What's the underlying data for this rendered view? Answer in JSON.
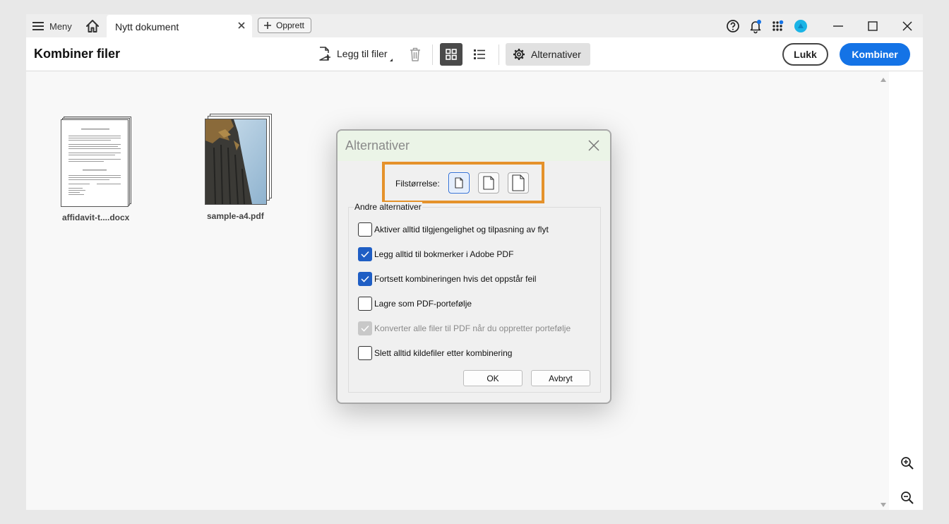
{
  "titlebar": {
    "menu_label": "Meny",
    "tab_title": "Nytt dokument",
    "new_label": "Opprett"
  },
  "toolbar": {
    "page_title": "Kombiner filer",
    "add_files_label": "Legg til filer",
    "options_label": "Alternativer",
    "close_label": "Lukk",
    "combine_label": "Kombiner"
  },
  "files": [
    {
      "name": "affidavit-t....docx",
      "icon": "document-thumbnail"
    },
    {
      "name": "sample-a4.pdf",
      "icon": "photo-thumbnail"
    }
  ],
  "dialog": {
    "title": "Alternativer",
    "filesize_label": "Filstørrelse:",
    "filesize_options": [
      "small",
      "medium",
      "large"
    ],
    "filesize_selected": "small",
    "group_title": "Andre alternativer",
    "options": [
      {
        "label": "Aktiver alltid tilgjengelighet og tilpasning av flyt",
        "checked": false,
        "disabled": false
      },
      {
        "label": "Legg alltid til bokmerker i Adobe PDF",
        "checked": true,
        "disabled": false
      },
      {
        "label": "Fortsett kombineringen hvis det oppstår feil",
        "checked": true,
        "disabled": false
      },
      {
        "label": "Lagre som PDF-portefølje",
        "checked": false,
        "disabled": false
      },
      {
        "label": "Konverter alle filer til PDF når du oppretter portefølje",
        "checked": true,
        "disabled": true
      },
      {
        "label": "Slett alltid kildefiler etter kombinering",
        "checked": false,
        "disabled": false
      }
    ],
    "ok_label": "OK",
    "cancel_label": "Avbryt"
  },
  "colors": {
    "accent": "#1473e6",
    "highlight": "#e5922b",
    "checkbox": "#1f5ec4"
  }
}
